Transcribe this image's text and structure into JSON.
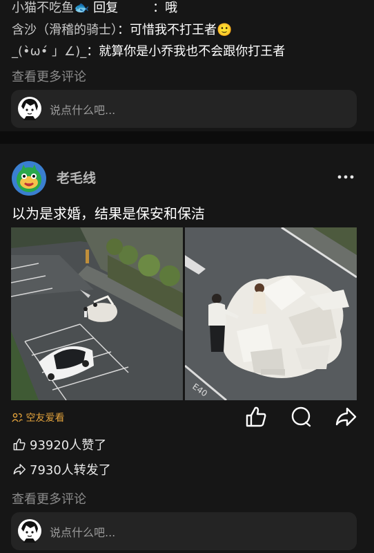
{
  "top_comments": {
    "replies": [
      {
        "name": "小猫不吃鱼🐟",
        "verb": " 回复",
        "target": "",
        "sep": "：",
        "text": "哦"
      },
      {
        "name": "含沙（滑稽的骑士）",
        "verb": "",
        "target": "",
        "sep": "：",
        "text": "可惜我不打王者🙂"
      },
      {
        "name": "_(•̀ω•́ 」∠)_",
        "verb": "",
        "target": "",
        "sep": "：",
        "text": "就算你是小乔我也不会跟你打王者"
      }
    ],
    "more_comments": "查看更多评论",
    "comment_placeholder": "说点什么吧..."
  },
  "post": {
    "author": "老毛线",
    "text": "以为是求婚，结果是保安和保洁",
    "friends_label": "空友爱看",
    "likes": "93920人赞了",
    "shares": "7930人转发了",
    "more_comments": "查看更多评论",
    "comment_placeholder": "说点什么吧...",
    "road_marking": "E40"
  },
  "colors": {
    "background": "#0c0c0c",
    "card": "#161616",
    "input": "#242424",
    "accent": "#e2a23c",
    "muted": "#8c8c8c"
  },
  "icons": [
    "fish-emoji",
    "smile-emoji",
    "more-dots-icon",
    "friends-icon",
    "like-icon",
    "comment-icon",
    "share-icon"
  ]
}
